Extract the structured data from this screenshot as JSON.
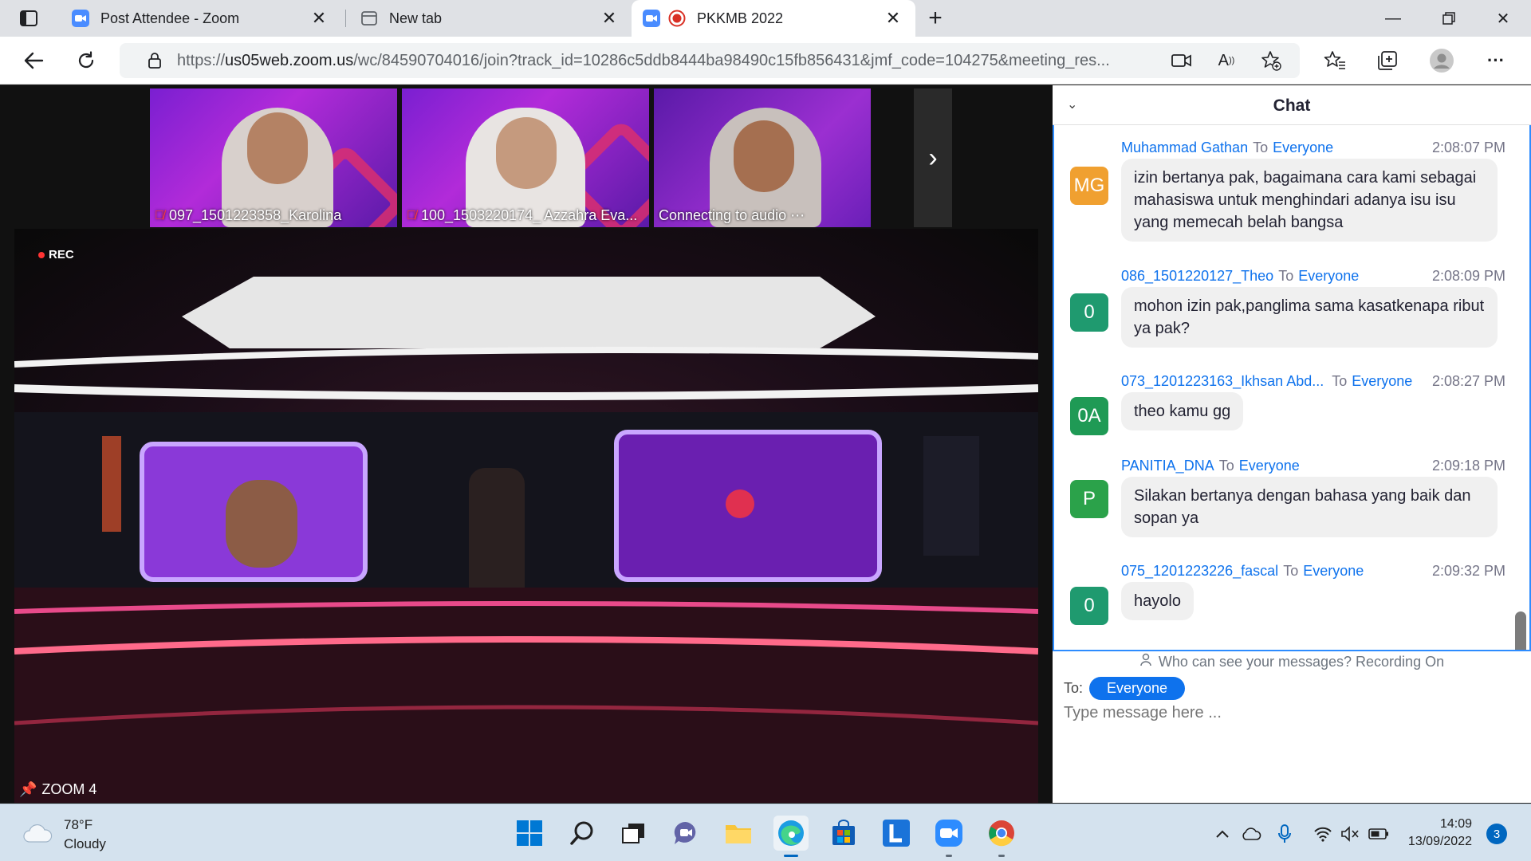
{
  "browser": {
    "tabs": [
      {
        "title": "Post Attendee - Zoom",
        "active": false
      },
      {
        "title": "New tab",
        "active": false
      },
      {
        "title": "PKKMB 2022",
        "active": true
      }
    ],
    "url_prefix": "https://",
    "url_host": "us05web.zoom.us",
    "url_rest": "/wc/84590704016/join?track_id=10286c5ddb8444ba98490c15fb856431&jmf_code=104275&meeting_res..."
  },
  "zoom": {
    "thumbnails": [
      {
        "label": "097_1501223358_Karolina",
        "muted": true
      },
      {
        "label": "100_1503220174_ Azzahra Eva...",
        "muted": true
      },
      {
        "label": "Connecting to audio ⋯",
        "muted": false
      }
    ],
    "recording_label": "REC",
    "active_speaker": "ZOOM 4"
  },
  "chat": {
    "title": "Chat",
    "messages": [
      {
        "sender": "Muhammad Gathan",
        "to_label": "To",
        "target": "Everyone",
        "time": "2:08:07 PM",
        "initials": "MG",
        "avatar_color": "#f0a030",
        "text": "izin bertanya pak, bagaimana cara kami sebagai mahasiswa untuk menghindari adanya isu isu yang memecah belah bangsa"
      },
      {
        "sender": "086_1501220127_Theo",
        "to_label": "To",
        "target": "Everyone",
        "time": "2:08:09 PM",
        "initials": "0",
        "avatar_color": "#1f9a6f",
        "text": "mohon izin pak,panglima sama kasatkenapa ribut ya pak?"
      },
      {
        "sender": "073_1201223163_Ikhsan Abd...",
        "to_label": "To",
        "target": "Everyone",
        "time": "2:08:27 PM",
        "initials": "0A",
        "avatar_color": "#1f9a55",
        "text": "theo kamu gg"
      },
      {
        "sender": "PANITIA_DNA",
        "to_label": "To",
        "target": "Everyone",
        "time": "2:09:18 PM",
        "initials": "P",
        "avatar_color": "#2ba24a",
        "text": "Silakan bertanya dengan bahasa yang baik dan sopan ya"
      },
      {
        "sender": "075_1201223226_fascal",
        "to_label": "To",
        "target": "Everyone",
        "time": "2:09:32 PM",
        "initials": "0",
        "avatar_color": "#1f9a6f",
        "text": "hayolo"
      }
    ],
    "privacy_note": "Who can see your messages? Recording On",
    "to_label": "To:",
    "recipient": "Everyone",
    "input_placeholder": "Type message here ..."
  },
  "taskbar": {
    "weather_temp": "78°F",
    "weather_desc": "Cloudy",
    "time": "14:09",
    "date": "13/09/2022",
    "notification_count": "3"
  }
}
